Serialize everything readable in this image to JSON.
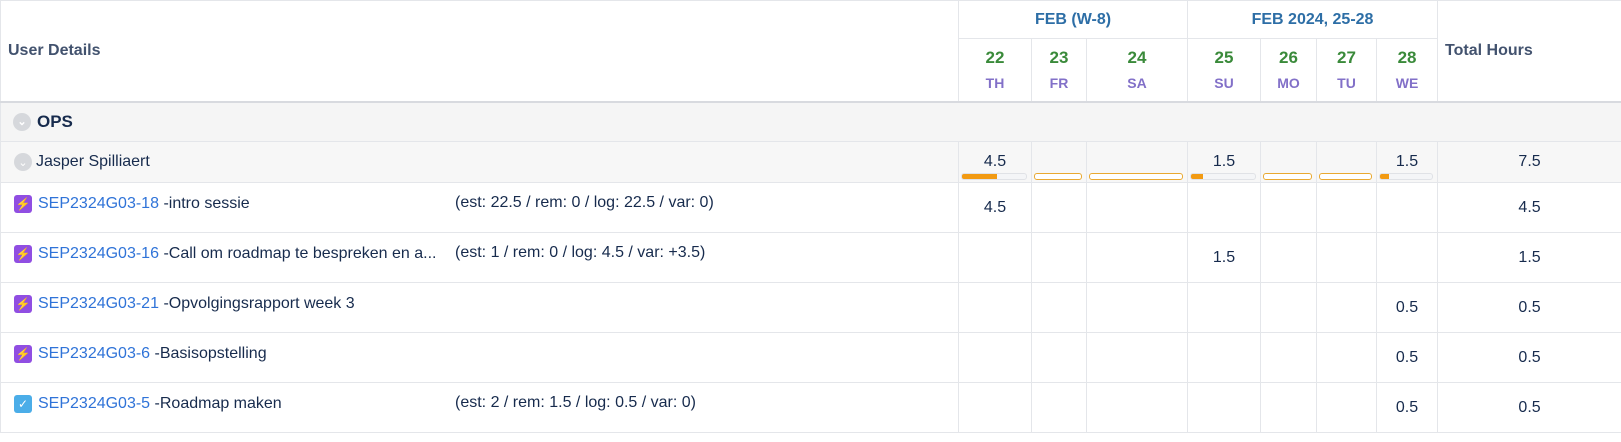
{
  "header": {
    "user_details": "User Details",
    "total_hours": "Total Hours",
    "months": [
      {
        "label": "FEB (W-8)"
      },
      {
        "label": "FEB 2024, 25-28"
      }
    ],
    "days": [
      {
        "num": "22",
        "wd": "TH"
      },
      {
        "num": "23",
        "wd": "FR"
      },
      {
        "num": "24",
        "wd": "SA"
      },
      {
        "num": "25",
        "wd": "SU"
      },
      {
        "num": "26",
        "wd": "MO"
      },
      {
        "num": "27",
        "wd": "TU"
      },
      {
        "num": "28",
        "wd": "WE"
      }
    ]
  },
  "group": {
    "label": "OPS",
    "icon": "chevron-down-icon"
  },
  "user": {
    "name": "Jasper Spilliaert",
    "icon": "chevron-down-icon",
    "hours": [
      "4.5",
      "",
      "",
      "1.5",
      "",
      "",
      "1.5"
    ],
    "progress": [
      0.55,
      0,
      0,
      0.18,
      0,
      0,
      0.18
    ],
    "total": "7.5"
  },
  "tasks": [
    {
      "key": "SEP2324G03-18",
      "title": "-intro sessie",
      "est": "(est: 22.5 / rem: 0 / log: 22.5 / var: 0)",
      "icon": "epic-icon",
      "hours": [
        "4.5",
        "",
        "",
        "",
        "",
        "",
        ""
      ],
      "total": "4.5"
    },
    {
      "key": "SEP2324G03-16",
      "title": "-Call om roadmap te bespreken en a...",
      "est": "(est: 1 / rem: 0 / log: 4.5 / var: +3.5)",
      "icon": "epic-icon",
      "hours": [
        "",
        "",
        "",
        "1.5",
        "",
        "",
        ""
      ],
      "total": "1.5"
    },
    {
      "key": "SEP2324G03-21",
      "title": "-Opvolgingsrapport week 3",
      "est": "",
      "icon": "epic-icon",
      "hours": [
        "",
        "",
        "",
        "",
        "",
        "",
        "0.5"
      ],
      "total": "0.5"
    },
    {
      "key": "SEP2324G03-6",
      "title": "-Basisopstelling",
      "est": "",
      "icon": "epic-icon",
      "hours": [
        "",
        "",
        "",
        "",
        "",
        "",
        "0.5"
      ],
      "total": "0.5"
    },
    {
      "key": "SEP2324G03-5",
      "title": "-Roadmap maken",
      "est": "(est: 2 / rem: 1.5 / log: 0.5 / var: 0)",
      "icon": "task-icon",
      "hours": [
        "",
        "",
        "",
        "",
        "",
        "",
        "0.5"
      ],
      "total": "0.5"
    }
  ],
  "colors": {
    "accent": "#2f73d8",
    "day_num": "#3a8a3a",
    "weekday": "#8270c8",
    "bar": "#f29a12"
  }
}
